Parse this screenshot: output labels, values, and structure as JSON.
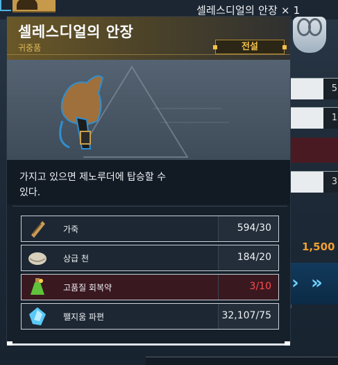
{
  "background": {
    "item_title": "셀레스디얼의 안장 × 1",
    "price": "1,500",
    "right_column_values": [
      "5",
      "1",
      "3"
    ],
    "faded_row_label": "팰지움 파편"
  },
  "tooltip": {
    "title": "셀레스디얼의 안장",
    "category": "귀중품",
    "rarity": "전설",
    "description": "가지고 있으면 제노루더에 탑승할 수 있다."
  },
  "materials": [
    {
      "name": "가죽",
      "count": "594/30",
      "icon": "leather-icon",
      "sufficient": true
    },
    {
      "name": "상급 천",
      "count": "184/20",
      "icon": "fine-cloth-icon",
      "sufficient": true
    },
    {
      "name": "고품질 회복약",
      "count": "3/10",
      "icon": "potion-icon",
      "sufficient": false
    },
    {
      "name": "팰지움 파편",
      "count": "32,107/75",
      "icon": "paldium-fragment-icon",
      "sufficient": true
    }
  ],
  "colors": {
    "legendary_gold": "#f5c14a",
    "shortage_red": "#ff4d4d",
    "accent_blue": "#6fd0ff",
    "price_orange": "#f0a030"
  }
}
